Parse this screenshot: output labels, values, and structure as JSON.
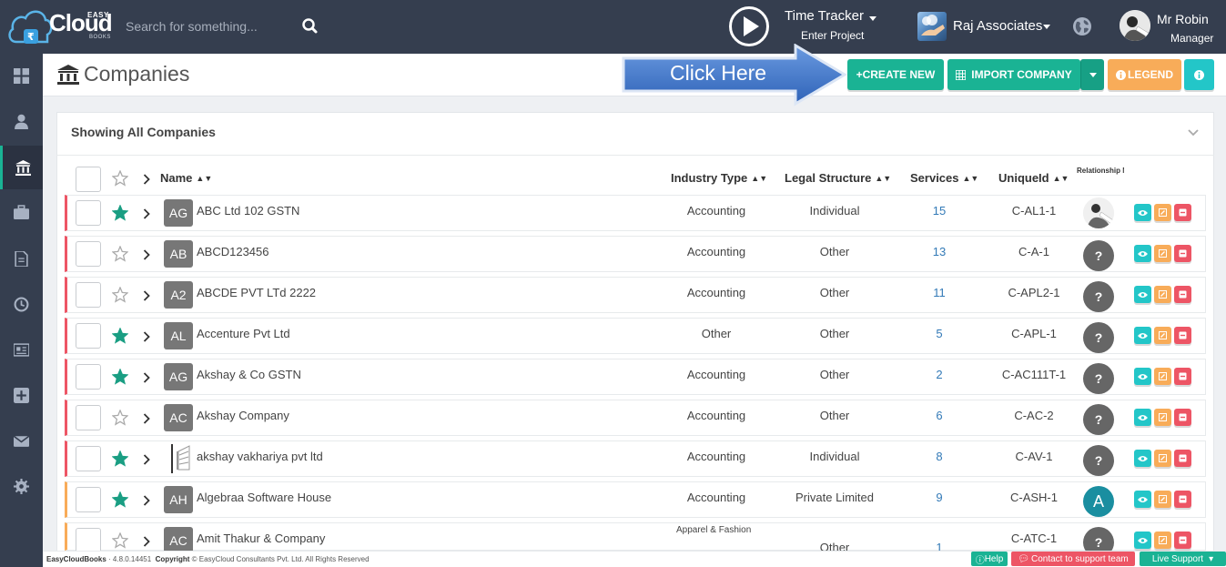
{
  "brand": {
    "easy": "EASY",
    "cloud": "Cloud",
    "books": "BOOKS"
  },
  "search": {
    "placeholder": "Search for something..."
  },
  "time_tracker": {
    "title": "Time Tracker",
    "sub": "Enter Project"
  },
  "org": {
    "name": "Raj Associates"
  },
  "user": {
    "name": "Mr Robin",
    "role": "Manager"
  },
  "page": {
    "title": "Companies"
  },
  "callout": {
    "text": "Click Here"
  },
  "buttons": {
    "create": "+CREATE NEW",
    "import": "IMPORT COMPANY",
    "legend": "LEGEND"
  },
  "card": {
    "title": "Showing All Companies"
  },
  "columns": {
    "name": "Name",
    "industry": "Industry Type",
    "legal": "Legal Structure",
    "services": "Services",
    "uid": "UniqueId",
    "rel": "Relationship Manager"
  },
  "rows": [
    {
      "badge": "AG",
      "name": "ABC Ltd 102 GSTN",
      "industry": "Accounting",
      "legal": "Individual",
      "services": "15",
      "uid": "C-AL1-1",
      "rel": "img",
      "starred": true,
      "status": "red"
    },
    {
      "badge": "AB",
      "name": "ABCD123456",
      "industry": "Accounting",
      "legal": "Other",
      "services": "13",
      "uid": "C-A-1",
      "rel": "?",
      "starred": false,
      "status": "red"
    },
    {
      "badge": "A2",
      "name": "ABCDE PVT LTd 2222",
      "industry": "Accounting",
      "legal": "Other",
      "services": "11",
      "uid": "C-APL2-1",
      "rel": "?",
      "starred": false,
      "status": "red"
    },
    {
      "badge": "AL",
      "name": "Accenture Pvt Ltd",
      "industry": "Other",
      "legal": "Other",
      "services": "5",
      "uid": "C-APL-1",
      "rel": "?",
      "starred": true,
      "status": "red"
    },
    {
      "badge": "AG",
      "name": "Akshay & Co GSTN",
      "industry": "Accounting",
      "legal": "Other",
      "services": "2",
      "uid": "C-AC111T-1",
      "rel": "?",
      "starred": true,
      "status": "red"
    },
    {
      "badge": "AC",
      "name": "Akshay Company",
      "industry": "Accounting",
      "legal": "Other",
      "services": "6",
      "uid": "C-AC-2",
      "rel": "?",
      "starred": false,
      "status": "red"
    },
    {
      "badge": "",
      "name": "akshay vakhariya pvt ltd",
      "industry": "Accounting",
      "legal": "Individual",
      "services": "8",
      "uid": "C-AV-1",
      "rel": "?",
      "starred": true,
      "status": "red"
    },
    {
      "badge": "AH",
      "name": "Algebraa Software House",
      "industry": "Accounting",
      "legal": "Private Limited",
      "services": "9",
      "uid": "C-ASH-1",
      "rel": "A",
      "starred": true,
      "status": "orange"
    },
    {
      "badge": "AC",
      "name": "Amit Thakur & Company",
      "industry": "Apparel & Fashion",
      "legal": "Other",
      "services": "1",
      "uid": "C-ATC-1",
      "rel": "?",
      "starred": false,
      "status": "orange"
    }
  ],
  "footer": {
    "app": "EasyCloudBooks",
    "version": "· 4.8.0.14451",
    "copyright_label": "Copyright",
    "copyright": "© EasyCloud Consultants Pvt. Ltd. All Rights Reserved",
    "help": "Help",
    "contact": "Contact to support team",
    "live": "Live Support"
  }
}
